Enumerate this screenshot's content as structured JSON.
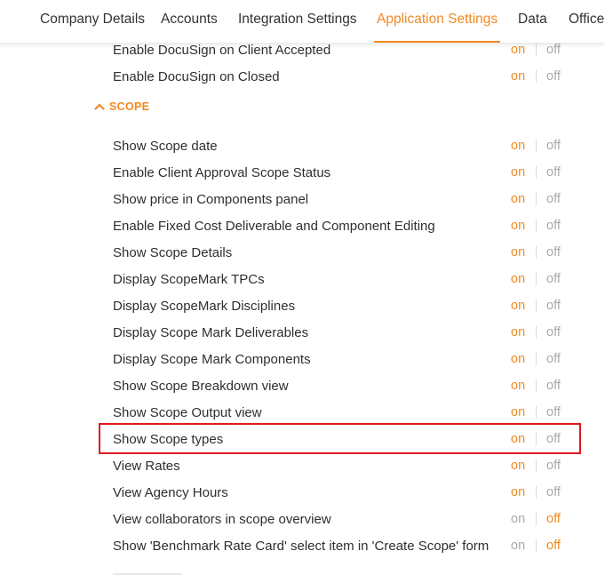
{
  "tabs": [
    {
      "label": "Company Details",
      "active": false
    },
    {
      "label": "Accounts",
      "active": false
    },
    {
      "label": "Integration Settings",
      "active": false
    },
    {
      "label": "Application Settings",
      "active": true
    },
    {
      "label": "Data",
      "active": false
    },
    {
      "label": "Office",
      "active": false
    }
  ],
  "toggle_labels": {
    "on": "on",
    "off": "off"
  },
  "colors": {
    "accent": "#f08a24",
    "highlight": "#e0191f",
    "inactive": "#a9a9a9"
  },
  "pre_settings": [
    {
      "label": "Enable DocuSign on Client Accepted",
      "value": "on"
    },
    {
      "label": "Enable DocuSign on Closed",
      "value": "on"
    }
  ],
  "scope_section": {
    "title": "SCOPE",
    "icon": "chevron-up-icon",
    "expanded": true,
    "settings": [
      {
        "label": "Show Scope date",
        "value": "on"
      },
      {
        "label": "Enable Client Approval Scope Status",
        "value": "on"
      },
      {
        "label": "Show price in Components panel",
        "value": "on"
      },
      {
        "label": "Enable Fixed Cost Deliverable and Component Editing",
        "value": "on"
      },
      {
        "label": "Show Scope Details",
        "value": "on"
      },
      {
        "label": "Display ScopeMark TPCs",
        "value": "on"
      },
      {
        "label": "Display ScopeMark Disciplines",
        "value": "on"
      },
      {
        "label": "Display Scope Mark Deliverables",
        "value": "on"
      },
      {
        "label": "Display Scope Mark Components",
        "value": "on"
      },
      {
        "label": "Show Scope Breakdown view",
        "value": "on"
      },
      {
        "label": "Show Scope Output view",
        "value": "on"
      },
      {
        "label": "Show Scope types",
        "value": "on",
        "highlighted": true
      },
      {
        "label": "View Rates",
        "value": "on"
      },
      {
        "label": "View Agency Hours",
        "value": "on"
      },
      {
        "label": "View collaborators in scope overview",
        "value": "off"
      },
      {
        "label": "Show 'Benchmark Rate Card' select item in 'Create Scope' form",
        "value": "off"
      }
    ]
  }
}
